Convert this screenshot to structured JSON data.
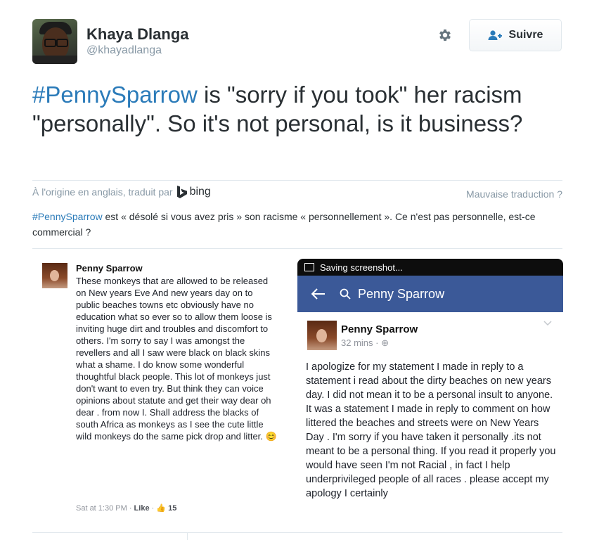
{
  "author": {
    "name": "Khaya Dlanga",
    "handle": "@khayadlanga"
  },
  "actions": {
    "follow_label": "Suivre",
    "settings_icon": "gear-icon"
  },
  "tweet": {
    "hashtag": "#PennySparrow",
    "text": " is \"sorry if you took\" her racism \"personally\". So it's not personal, is it business?"
  },
  "translation": {
    "source_label": "À l'origine en anglais, traduit par",
    "provider": "bing",
    "bad_translation_label": "Mauvaise traduction ?",
    "hashtag": "#PennySparrow",
    "text": " est « désolé si vous avez pris » son racisme « personnellement ». Ce n'est pas personnelle, est-ce commercial ?"
  },
  "image_left": {
    "name": "Penny Sparrow",
    "body": "These monkeys that are allowed to be released on New years Eve And new years day on to public beaches towns etc obviously have no education what so ever so to allow them loose is inviting huge dirt and troubles and discomfort to others. I'm sorry to say I was amongst the revellers and all I saw were black on black skins what a shame. I do know some wonderful thoughtful black people. This lot of monkeys just don't want to even try. But think they can voice opinions about statute and get their way dear oh dear . from now I. Shall address the blacks of south Africa as monkeys as I see the cute little wild monkeys do the same pick  drop and litter.",
    "time": "Sat at 1:30 PM",
    "like_label": "Like",
    "like_count": "15"
  },
  "image_right": {
    "status": "Saving screenshot...",
    "search_title": "Penny Sparrow",
    "name": "Penny Sparrow",
    "time": "32 mins ·",
    "body": "I apologize for my statement I made in reply to a statement i read about the dirty beaches on new years day. I did not mean it to be a personal insult to anyone. It was a statement I made in reply to comment on how littered the beaches and streets were on New Years Day . I'm sorry if you have taken it personally .its not meant to be a personal thing. If you read it properly you would have seen I'm not Racial , in fact I help underprivileged people of all races . please accept my apology I certainly",
    "header_color": "#3b5998"
  },
  "colors": {
    "link": "#2b7bb9",
    "muted": "#8899a6",
    "text": "#292f33"
  }
}
